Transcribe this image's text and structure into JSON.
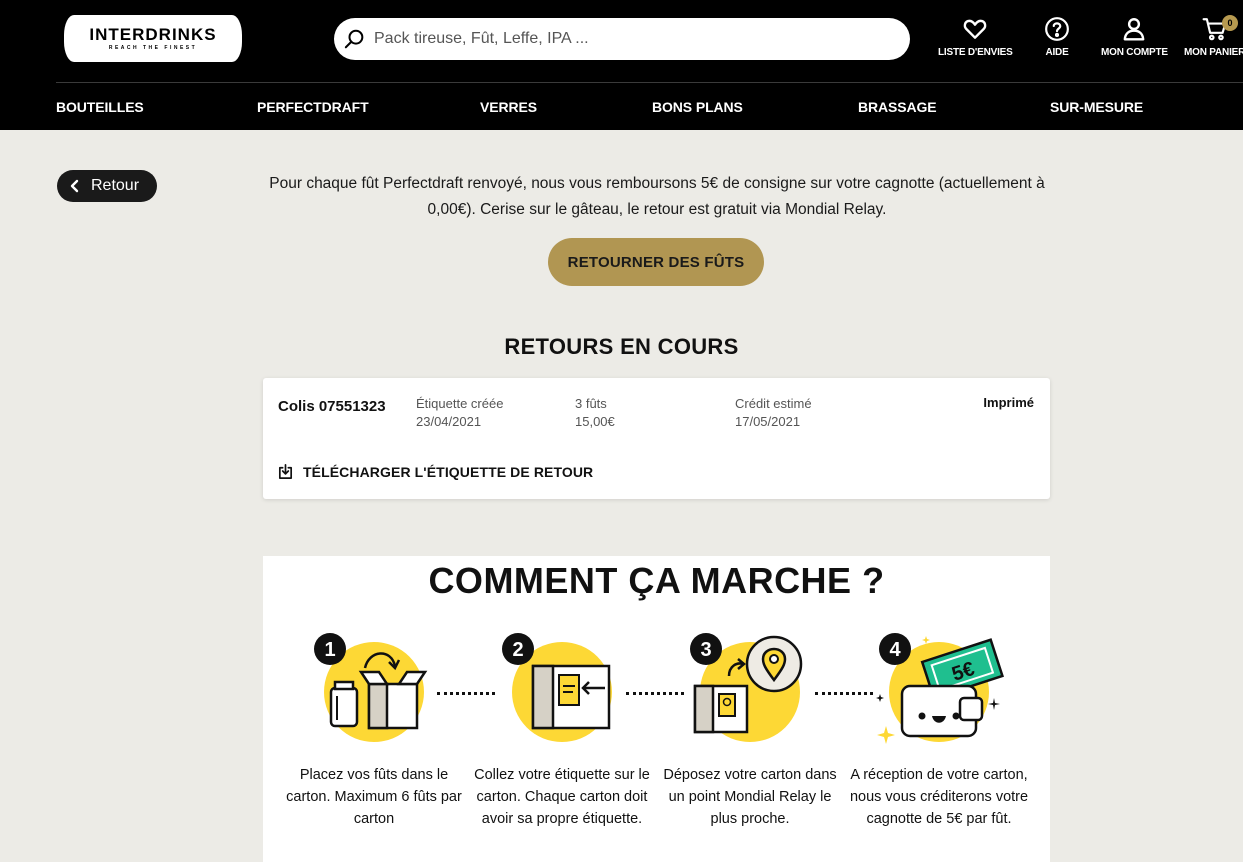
{
  "brand": {
    "name": "INTERDRINKS",
    "tagline": "REACH THE FINEST"
  },
  "search": {
    "placeholder": "Pack tireuse, Fût, Leffe, IPA ..."
  },
  "header_actions": {
    "wishlist": "LISTE D'ENVIES",
    "help": "AIDE",
    "account": "MON COMPTE",
    "cart": "MON PANIER",
    "cart_count": "0"
  },
  "nav": [
    "BOUTEILLES",
    "PERFECTDRAFT",
    "VERRES",
    "BONS PLANS",
    "BRASSAGE",
    "SUR-MESURE"
  ],
  "back": {
    "label": "Retour"
  },
  "intro": "Pour chaque fût Perfectdraft renvoyé, nous vous remboursons 5€ de consigne sur votre cagnotte (actuellement à 0,00€). Cerise sur le gâteau, le retour est gratuit via Mondial Relay.",
  "cta": "RETOURNER DES FÛTS",
  "returns": {
    "title": "RETOURS EN COURS",
    "items": [
      {
        "colis": "Colis 07551323",
        "label_title": "Étiquette créée",
        "label_date": "23/04/2021",
        "kegs": "3 fûts",
        "amount": "15,00€",
        "credit_title": "Crédit estimé",
        "credit_date": "17/05/2021",
        "status": "Imprimé",
        "download": "TÉLÉCHARGER L'ÉTIQUETTE DE RETOUR"
      }
    ]
  },
  "how": {
    "title": "COMMENT ÇA MARCHE ?",
    "steps": [
      {
        "num": "1",
        "text": "Placez vos fûts dans le carton. Maximum 6 fûts par carton"
      },
      {
        "num": "2",
        "text": "Collez votre étiquette sur le carton. Chaque carton doit avoir sa propre étiquette."
      },
      {
        "num": "3",
        "text": "Déposez votre carton dans un point Mondial Relay le plus proche."
      },
      {
        "num": "4",
        "text": "A réception de votre carton, nous vous créditerons votre cagnotte de 5€ par fût."
      }
    ],
    "bill_amount": "5€"
  },
  "colors": {
    "accent": "#b19652",
    "yellow": "#fdd835",
    "green": "#1fbf8f",
    "dark": "#000000"
  }
}
